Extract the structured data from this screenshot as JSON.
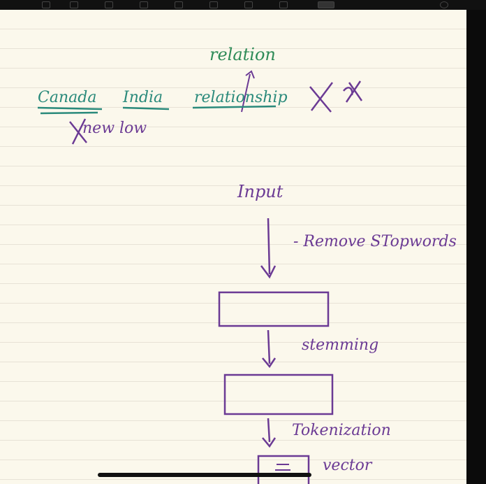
{
  "notes": {
    "top": {
      "correction": "relation",
      "words": [
        "Canada",
        "India",
        "relationship"
      ],
      "second_line": "new low"
    },
    "flow": {
      "input": "Input",
      "step1": "- Remove STopwords",
      "step2": "stemming",
      "step3": "Tokenization",
      "step4": "vector"
    }
  },
  "colors": {
    "paper": "#fbf8ec",
    "rule_line": "#e7e2d6",
    "green_ink": "#2e8b57",
    "purple_ink": "#6b3a94",
    "teal_underline": "#2a8a7b"
  }
}
